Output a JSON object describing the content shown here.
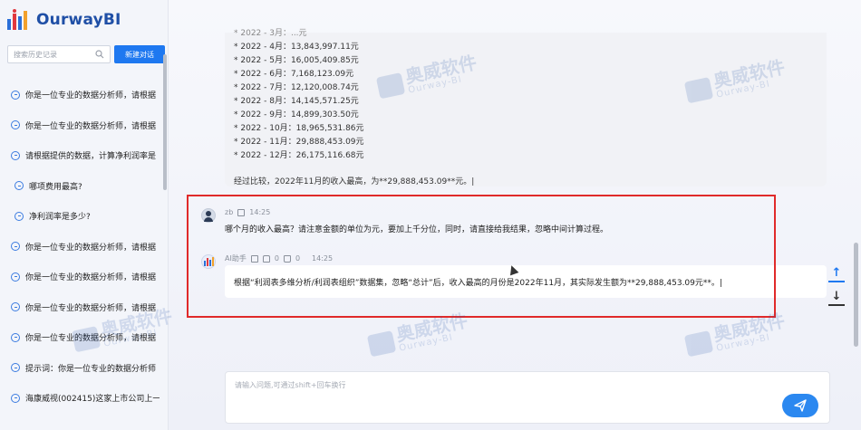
{
  "app": {
    "name": "OurwayBI"
  },
  "sidebar": {
    "search_placeholder": "搜索历史记录",
    "new_chat_label": "新建对话",
    "history": [
      "你是一位专业的数据分析师，请根据",
      "你是一位专业的数据分析师，请根据",
      "请根据提供的数据，计算净利润率是",
      "哪项费用最高?",
      "净利润率是多少?",
      "你是一位专业的数据分析师，请根据",
      "你是一位专业的数据分析师，请根据",
      "你是一位专业的数据分析师，请根据",
      "你是一位专业的数据分析师，请根据",
      "提示词：你是一位专业的数据分析师",
      "海康威视(002415)这家上市公司上一"
    ]
  },
  "chat": {
    "partial_top_line": "* 2022 - 3月：...元",
    "monthly_lines": [
      "* 2022 - 4月：13,843,997.11元",
      "* 2022 - 5月：16,005,409.85元",
      "* 2022 - 6月：7,168,123.09元",
      "* 2022 - 7月：12,120,008.74元",
      "* 2022 - 8月：14,145,571.25元",
      "* 2022 - 9月：14,899,303.50元",
      "* 2022 - 10月：18,965,531.86元",
      "* 2022 - 11月：29,888,453.09元",
      "* 2022 - 12月：26,175,116.68元"
    ],
    "conclusion": "经过比较，2022年11月的收入最高，为**29,888,453.09**元。|",
    "user_name": "zb",
    "user_time": "14:25",
    "user_message": "哪个月的收入最高？请注意金额的单位为元，要加上千分位，同时，请直接给我结果，忽略中间计算过程。",
    "ai_name": "AI助手",
    "ai_like_count": "0",
    "ai_dislike_count": "0",
    "ai_time": "14:25",
    "ai_message": "根据“利润表多维分析/利润表组织”数据集，忽略“总计”后，收入最高的月份是2022年11月，其实际发生额为**29,888,453.09元**。|"
  },
  "input": {
    "placeholder": "请输入问题,可通过shift+回车换行"
  },
  "watermark": {
    "cn": "奥威软件",
    "en": "Ourway-BI"
  },
  "colors": {
    "accent": "#1e78f0",
    "highlight_box": "#e02a2a",
    "brand": "#1f4fa6"
  }
}
